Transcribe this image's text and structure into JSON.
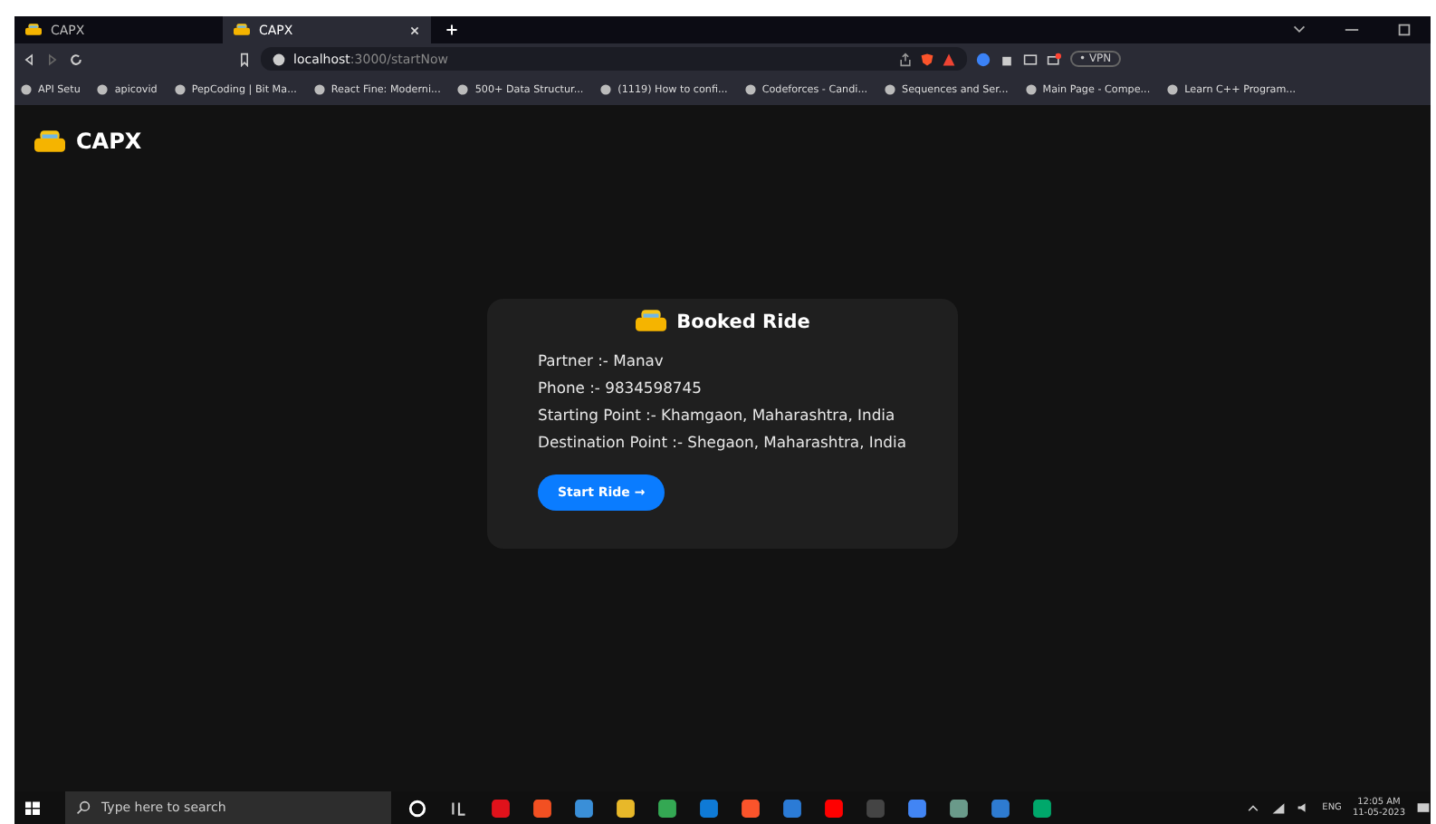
{
  "browser": {
    "tabs": [
      {
        "title": "CAPX",
        "selected": false
      },
      {
        "title": "CAPX",
        "selected": true
      }
    ],
    "address": {
      "host": "localhost",
      "path": ":3000/startNow"
    },
    "vpn": "• VPN",
    "bookmarks": [
      "API Setu",
      "apicovid",
      "PepCoding | Bit Ma...",
      "React Fine: Moderni...",
      "500+ Data Structur...",
      "(1119) How to confi...",
      "Codeforces - Candi...",
      "Sequences and Ser...",
      "Main Page - Compe...",
      "Learn C++ Program..."
    ]
  },
  "app": {
    "brand": "CAPX",
    "card": {
      "title": "Booked Ride",
      "details": [
        "Partner :- Manav",
        "Phone :- 9834598745",
        "Starting Point :- Khamgaon, Maharashtra, India",
        "Destination Point :- Shegaon, Maharashtra, India"
      ],
      "button": "Start Ride →"
    }
  },
  "taskbar": {
    "search_placeholder": "Type here to search",
    "language": "ENG",
    "time": "12:05 AM",
    "date": "11-05-2023"
  }
}
